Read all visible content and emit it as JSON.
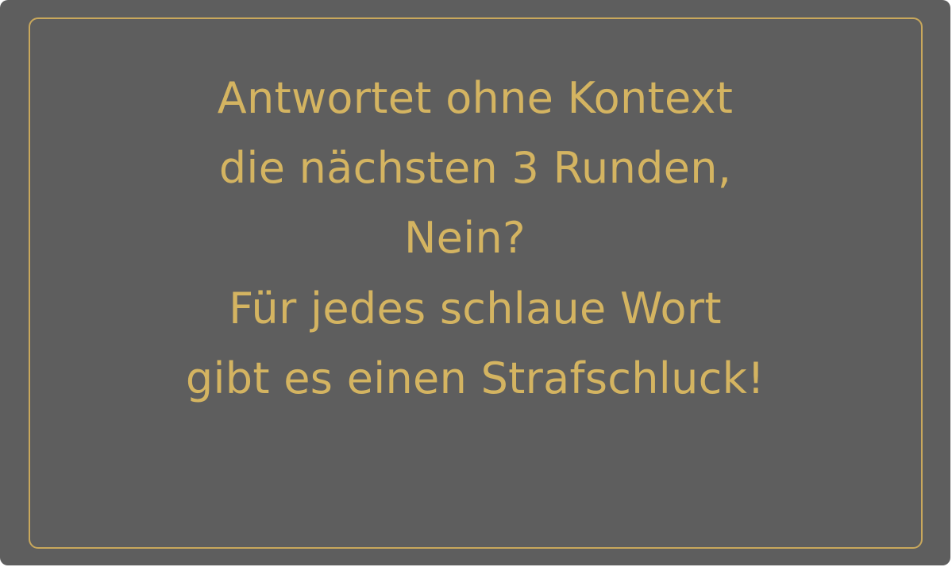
{
  "card": {
    "colors": {
      "background": "#5e5e5e",
      "border": "#c9a85c",
      "text": "#d4b461"
    },
    "lines": [
      "Antwortet ohne Kontext",
      "die nächsten 3 Runden,",
      "Nein?",
      "Für jedes schlaue Wort",
      "gibt es einen Strafschluck!"
    ]
  }
}
